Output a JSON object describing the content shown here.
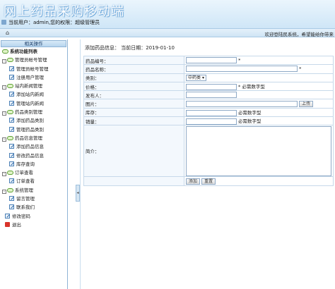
{
  "header": {
    "title": "网上药品采购移动端",
    "user_line": "当前用户：admin,您的权限：超级管理员"
  },
  "navbar": {
    "welcome": "欢迎登陆民系统，希望能给你带来"
  },
  "sidebar": {
    "heading": "相关操作",
    "root": "系统功能列表",
    "groups": [
      {
        "label": "管理员帐号管理",
        "items": [
          "管理员帐号管理",
          "注册用户管理"
        ]
      },
      {
        "label": "站内新闻管理",
        "items": [
          "添加站内新闻",
          "管理站内新闻"
        ]
      },
      {
        "label": "药品类别管理",
        "items": [
          "添加药品类别",
          "管理药品类别"
        ]
      },
      {
        "label": "药品信息管理",
        "items": [
          "添加药品信息",
          "修改药品信息",
          "库存查询"
        ]
      },
      {
        "label": "订单查看",
        "items": [
          "订单查看"
        ]
      },
      {
        "label": "系统管理",
        "items": [
          "留言管理",
          "联系我们"
        ]
      }
    ],
    "change_password": "修改密码",
    "logout": "退出"
  },
  "main": {
    "info": "添加药品信息：  当前日期：2019-01-10",
    "fields": {
      "code_label": "药品编号：",
      "name_label": "药品名称：",
      "category_label": "类别：",
      "category_value": "中药类",
      "price_label": "价格：",
      "publisher_label": "发布人：",
      "image_label": "图片：",
      "upload_label": "上传",
      "stock_label": "库存：",
      "sales_label": "销量：",
      "intro_label": "简介：",
      "required_mark": "*",
      "number_hint": "必需数字型",
      "price_hint": "* 必需数字型"
    },
    "buttons": {
      "add": "添加",
      "reset": "重置"
    }
  }
}
